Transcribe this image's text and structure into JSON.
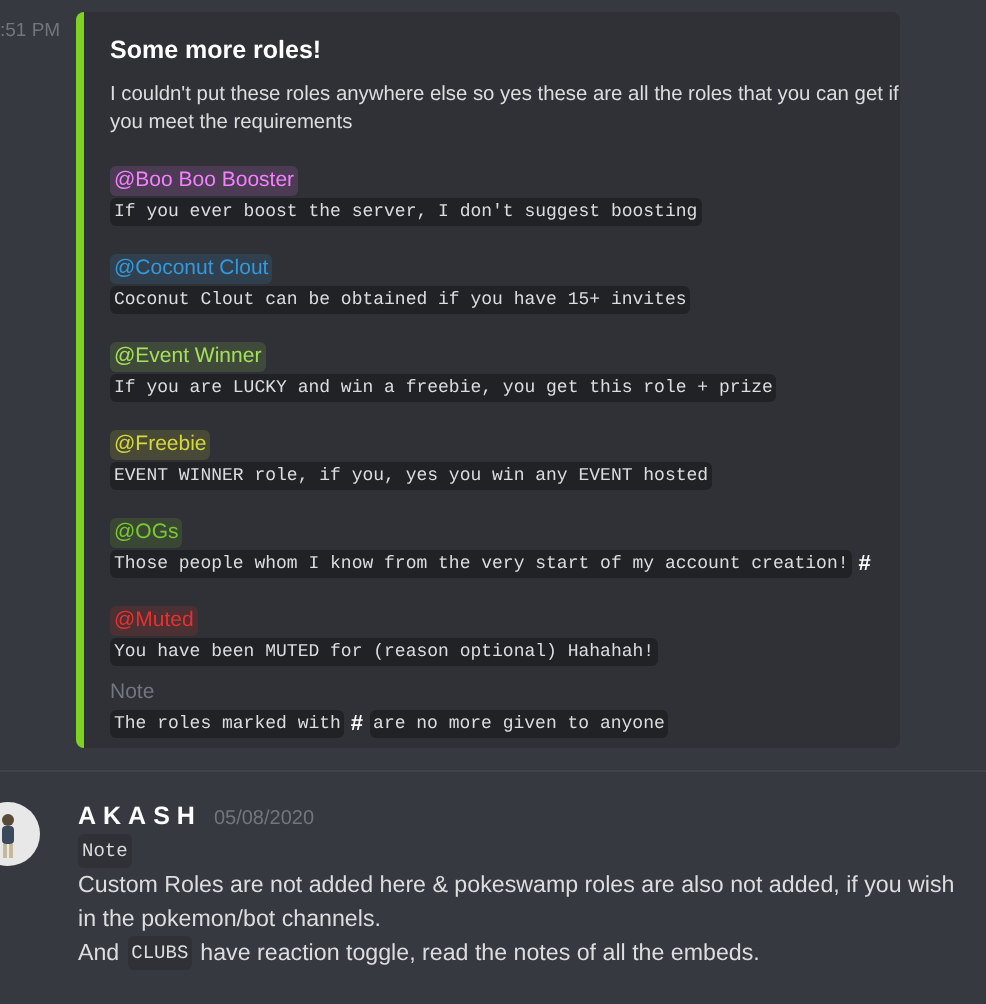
{
  "embed_message": {
    "timestamp": ":51 PM",
    "embed": {
      "title": "Some more roles!",
      "description": "I couldn't put these roles anywhere else so yes these are all the roles that you can get if you meet the requirements",
      "fields": [
        {
          "name": {
            "kind": "mention",
            "text": "@Boo Boo Booster",
            "color": "#f47fff"
          },
          "value": [
            {
              "kind": "code",
              "text": "If you ever boost the server, I don't suggest boosting"
            }
          ]
        },
        {
          "name": {
            "kind": "mention",
            "text": "@Coconut Clout",
            "color": "#3498db"
          },
          "value": [
            {
              "kind": "code",
              "text": "Coconut Clout can be obtained if you have 15+ invites"
            }
          ]
        },
        {
          "name": {
            "kind": "mention",
            "text": "@Event Winner",
            "color": "#a3e05a"
          },
          "value": [
            {
              "kind": "code",
              "text": "If you are LUCKY and win a freebie, you get this role + prize"
            }
          ]
        },
        {
          "name": {
            "kind": "mention",
            "text": "@Freebie",
            "color": "#d4d83a"
          },
          "value": [
            {
              "kind": "code",
              "text": "EVENT WINNER role, if you, yes you win any EVENT hosted"
            }
          ]
        },
        {
          "name": {
            "kind": "mention",
            "text": "@OGs",
            "color": "#78c832"
          },
          "value": [
            {
              "kind": "code",
              "text": "Those people whom I know from the very start of my account creation!"
            },
            {
              "kind": "bold",
              "text": "#"
            }
          ]
        },
        {
          "name": {
            "kind": "mention",
            "text": "@Muted",
            "color": "#e8312f"
          },
          "value": [
            {
              "kind": "code",
              "text": "You have been MUTED for (reason optional) Hahahah!"
            }
          ]
        },
        {
          "name": {
            "kind": "plain",
            "text": "Note"
          },
          "value": [
            {
              "kind": "code",
              "text": "The roles marked with"
            },
            {
              "kind": "bold",
              "text": "#"
            },
            {
              "kind": "code",
              "text": "are no more given to anyone"
            }
          ]
        }
      ]
    }
  },
  "message": {
    "author": "AKASH",
    "date": "05/08/2020",
    "lines": [
      [
        {
          "kind": "code",
          "text": "Note"
        }
      ],
      [
        {
          "kind": "text",
          "text": "Custom Roles are not added here & pokeswamp roles are also not added, if you wish"
        }
      ],
      [
        {
          "kind": "text",
          "text": "in the pokemon/bot channels."
        }
      ],
      [
        {
          "kind": "text",
          "text": "And"
        },
        {
          "kind": "code",
          "text": "CLUBS"
        },
        {
          "kind": "text",
          "text": "have reaction toggle, read the notes of all the embeds."
        }
      ]
    ]
  }
}
